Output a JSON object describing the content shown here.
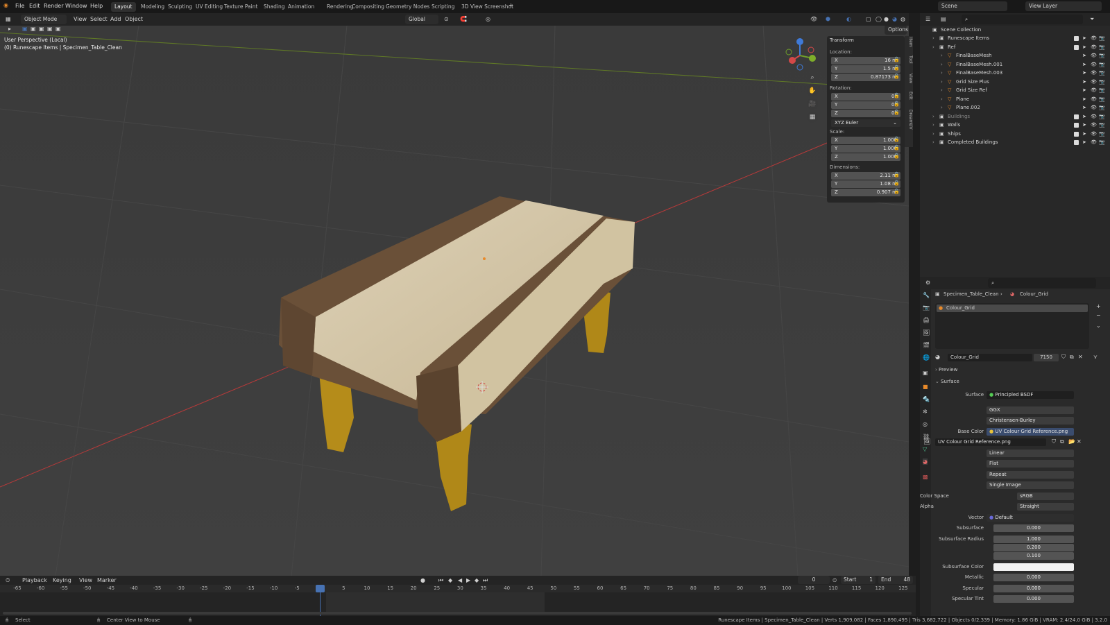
{
  "menu": {
    "file": "File",
    "edit": "Edit",
    "render": "Render",
    "window": "Window",
    "help": "Help"
  },
  "workspaces": [
    "Layout",
    "Modeling",
    "Sculpting",
    "UV Editing",
    "Texture Paint",
    "Shading",
    "Animation",
    "Rendering",
    "Compositing",
    "Geometry Nodes",
    "Scripting",
    "3D View Screenshot"
  ],
  "active_workspace": "Layout",
  "scene": {
    "label": "Scene",
    "view_layer": "View Layer"
  },
  "viewport_header": {
    "mode": "Object Mode",
    "view": "View",
    "select": "Select",
    "add": "Add",
    "object": "Object",
    "transform_orientation": "Global",
    "options": "Options"
  },
  "viewport": {
    "perspective": "User Perspective (Local)",
    "context": "(0) Runescape Items | Specimen_Table_Clean"
  },
  "transform": {
    "title": "Transform",
    "location_label": "Location:",
    "location": [
      {
        "axis": "X",
        "value": "16 m"
      },
      {
        "axis": "Y",
        "value": "1.5 m"
      },
      {
        "axis": "Z",
        "value": "0.87173 m"
      }
    ],
    "rotation_label": "Rotation:",
    "rotation": [
      {
        "axis": "X",
        "value": "0°"
      },
      {
        "axis": "Y",
        "value": "0°"
      },
      {
        "axis": "Z",
        "value": "0°"
      }
    ],
    "rotation_mode": "XYZ Euler",
    "scale_label": "Scale:",
    "scale": [
      {
        "axis": "X",
        "value": "1.000"
      },
      {
        "axis": "Y",
        "value": "1.000"
      },
      {
        "axis": "Z",
        "value": "1.000"
      }
    ],
    "dimensions_label": "Dimensions:",
    "dimensions": [
      {
        "axis": "X",
        "value": "2.11 m"
      },
      {
        "axis": "Y",
        "value": "1.08 m"
      },
      {
        "axis": "Z",
        "value": "0.907 m"
      }
    ]
  },
  "npanel_tabs": [
    "Item",
    "Tool",
    "View",
    "Edit",
    "DreamUV"
  ],
  "outliner": {
    "root": "Scene Collection",
    "items": [
      {
        "name": "Runescape Items"
      },
      {
        "name": "Ref"
      },
      {
        "name": "FinalBaseMesh"
      },
      {
        "name": "FinalBaseMesh.001"
      },
      {
        "name": "FinalBaseMesh.003"
      },
      {
        "name": "Grid Size Plus"
      },
      {
        "name": "Grid Size Ref"
      },
      {
        "name": "Plane"
      },
      {
        "name": "Plane.002"
      },
      {
        "name": "Buildings"
      },
      {
        "name": "Walls"
      },
      {
        "name": "Ships"
      },
      {
        "name": "Completed Buildings"
      }
    ]
  },
  "properties": {
    "breadcrumb_object": "Specimen_Table_Clean",
    "breadcrumb_material": "Colour_Grid",
    "slot": "Colour_Grid",
    "material_name": "Colour_Grid",
    "users": "7150",
    "preview": "Preview",
    "surface_section": "Surface",
    "surface_label": "Surface",
    "surface_value": "Principled BSDF",
    "distribution": "GGX",
    "subsurface_method": "Christensen-Burley",
    "base_color_label": "Base Color",
    "base_color_value": "UV Colour Grid Reference.png",
    "image_name": "UV Colour Grid Reference.png",
    "interpolation": "Linear",
    "projection": "Flat",
    "extension": "Repeat",
    "source": "Single Image",
    "color_space_label": "Color Space",
    "color_space": "sRGB",
    "alpha_label": "Alpha",
    "alpha": "Straight",
    "vector_label": "Vector",
    "vector": "Default",
    "subsurface_label": "Subsurface",
    "subsurface": "0.000",
    "subsurface_radius_label": "Subsurface Radius",
    "subsurface_radius": [
      "1.000",
      "0.200",
      "0.100"
    ],
    "subsurface_color_label": "Subsurface Color",
    "metallic_label": "Metallic",
    "metallic": "0.000",
    "specular_label": "Specular",
    "specular": "0.000",
    "specular_tint_label": "Specular Tint",
    "specular_tint": "0.000"
  },
  "timeline": {
    "playback": "Playback",
    "keying": "Keying",
    "view": "View",
    "marker": "Marker",
    "current_frame": "0",
    "start_label": "Start",
    "start": "1",
    "end_label": "End",
    "end": "48",
    "ticks": [
      "-65",
      "-60",
      "-55",
      "-50",
      "-45",
      "-40",
      "-35",
      "-30",
      "-25",
      "-20",
      "-15",
      "-10",
      "-5",
      "0",
      "5",
      "10",
      "15",
      "20",
      "25",
      "30",
      "35",
      "40",
      "45",
      "50",
      "55",
      "60",
      "65",
      "70",
      "75",
      "80",
      "85",
      "90",
      "95",
      "100",
      "105",
      "110",
      "115",
      "120",
      "125"
    ]
  },
  "status": {
    "select": "Select",
    "center_view": "Center View to Mouse",
    "stats": "Runescape Items | Specimen_Table_Clean | Verts 1,909,082 | Faces 1,890,495 | Tris 3,682,722 | Objects 0/2,339 | Memory: 1.86 GiB | VRAM: 2.4/24.0 GiB | 3.2.0"
  },
  "colors": {
    "accent": "#4772b3",
    "table_cloth": "#d6c8a8",
    "table_trim": "#5e4631",
    "table_leg": "#b08818",
    "grid_red": "#b83a3a",
    "grid_green": "#6f8a2a"
  }
}
